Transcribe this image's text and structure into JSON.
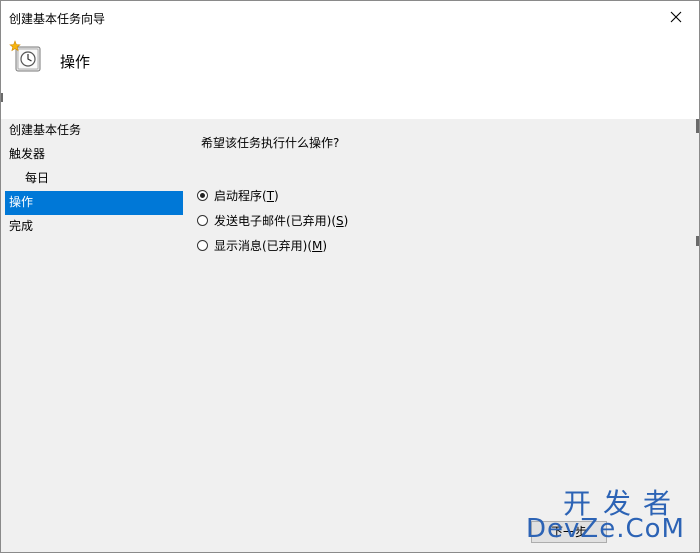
{
  "window": {
    "title": "创建基本任务向导",
    "close_glyph": "✕"
  },
  "header": {
    "icon": "task-scheduler-clock-icon",
    "title": "操作"
  },
  "nav": {
    "items": [
      {
        "label": "创建基本任务",
        "selected": false,
        "sub": false
      },
      {
        "label": "触发器",
        "selected": false,
        "sub": false
      },
      {
        "label": "每日",
        "selected": false,
        "sub": true
      },
      {
        "label": "操作",
        "selected": true,
        "sub": false
      },
      {
        "label": "完成",
        "selected": false,
        "sub": false
      }
    ]
  },
  "main": {
    "question": "希望该任务执行什么操作?",
    "options": [
      {
        "label": "启动程序(",
        "key": "T",
        "suffix": ")",
        "checked": true
      },
      {
        "label": "发送电子邮件(已弃用)(",
        "key": "S",
        "suffix": ")",
        "checked": false
      },
      {
        "label": "显示消息(已弃用)(",
        "key": "M",
        "suffix": ")",
        "checked": false
      }
    ]
  },
  "footer": {
    "partial_button_label": "下一步"
  },
  "watermark": {
    "line1": "开发者",
    "line2": "DevZe.CoM"
  },
  "colors": {
    "selection": "#0078d7",
    "body_bg": "#f0f0f0",
    "header_bg": "#ffffff",
    "watermark": "#2c63b5"
  }
}
